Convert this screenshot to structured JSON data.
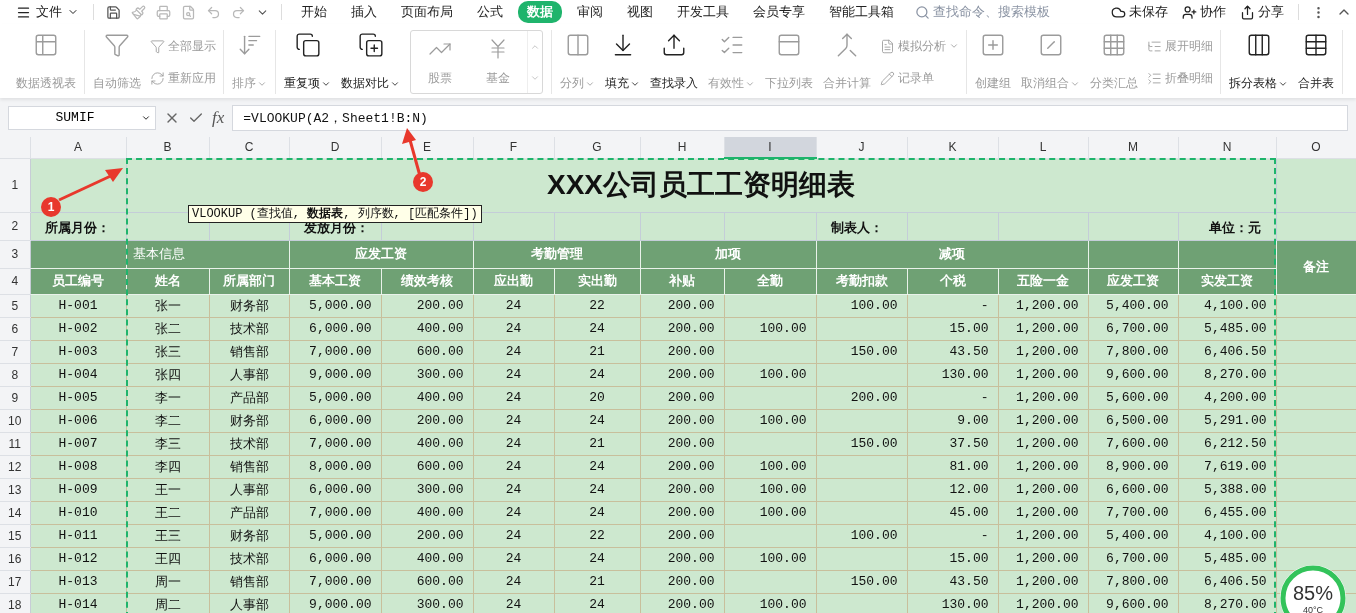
{
  "menu": {
    "file": "文件"
  },
  "tabs": [
    {
      "label": "开始",
      "selected": false
    },
    {
      "label": "插入",
      "selected": false
    },
    {
      "label": "页面布局",
      "selected": false
    },
    {
      "label": "公式",
      "selected": false
    },
    {
      "label": "数据",
      "selected": true
    },
    {
      "label": "审阅",
      "selected": false
    },
    {
      "label": "视图",
      "selected": false
    },
    {
      "label": "开发工具",
      "selected": false
    },
    {
      "label": "会员专享",
      "selected": false
    },
    {
      "label": "智能工具箱",
      "selected": false
    }
  ],
  "search": {
    "placeholder": "查找命令、搜索模板"
  },
  "top_actions": [
    "未保存",
    "协作",
    "分享"
  ],
  "ribbon": [
    {
      "items": [
        {
          "kind": "large",
          "label": "数据透视表",
          "disabled": true,
          "dropdown": false
        }
      ]
    },
    {
      "items": [
        {
          "kind": "large",
          "label": "自动筛选",
          "disabled": true,
          "dropdown": false
        },
        {
          "kind": "stack",
          "items": [
            {
              "label": "全部显示",
              "disabled": true,
              "dropdown": false
            },
            {
              "label": "重新应用",
              "disabled": true,
              "dropdown": false
            }
          ]
        }
      ]
    },
    {
      "items": [
        {
          "kind": "large",
          "label": "排序",
          "disabled": true,
          "dropdown": true
        }
      ]
    },
    {
      "items": [
        {
          "kind": "large",
          "label": "重复项",
          "disabled": false,
          "dropdown": true
        },
        {
          "kind": "large",
          "label": "数据对比",
          "disabled": false,
          "dropdown": true
        },
        {
          "kind": "gallery",
          "items": [
            {
              "label": "股票",
              "disabled": true
            },
            {
              "label": "基金",
              "disabled": true
            }
          ]
        }
      ]
    },
    {
      "items": [
        {
          "kind": "large",
          "label": "分列",
          "disabled": true,
          "dropdown": true
        },
        {
          "kind": "large",
          "label": "填充",
          "disabled": false,
          "dropdown": true
        },
        {
          "kind": "large",
          "label": "查找录入",
          "disabled": false,
          "dropdown": false
        },
        {
          "kind": "large",
          "label": "有效性",
          "disabled": true,
          "dropdown": true
        },
        {
          "kind": "large",
          "label": "下拉列表",
          "disabled": true,
          "dropdown": false
        },
        {
          "kind": "large",
          "label": "合并计算",
          "disabled": true,
          "dropdown": false
        },
        {
          "kind": "stack",
          "items": [
            {
              "label": "模拟分析",
              "disabled": true,
              "dropdown": true
            },
            {
              "label": "记录单",
              "disabled": true,
              "dropdown": false
            }
          ]
        }
      ]
    },
    {
      "items": [
        {
          "kind": "large",
          "label": "创建组",
          "disabled": true,
          "dropdown": false
        },
        {
          "kind": "large",
          "label": "取消组合",
          "disabled": true,
          "dropdown": true
        },
        {
          "kind": "large",
          "label": "分类汇总",
          "disabled": true,
          "dropdown": false
        },
        {
          "kind": "stack",
          "items": [
            {
              "label": "展开明细",
              "disabled": true,
              "dropdown": false
            },
            {
              "label": "折叠明细",
              "disabled": true,
              "dropdown": false
            }
          ]
        }
      ]
    },
    {
      "items": [
        {
          "kind": "large",
          "label": "拆分表格",
          "disabled": false,
          "dropdown": true
        },
        {
          "kind": "large",
          "label": "合并表",
          "disabled": false,
          "dropdown": false
        }
      ]
    }
  ],
  "formula_bar": {
    "name_box": "SUMIF",
    "fx_label": "fx",
    "formula": "=VLOOKUP(A2，Sheet1!B:N)"
  },
  "column_letters": [
    {
      "letter": "A",
      "selected": false
    },
    {
      "letter": "B",
      "selected": false
    },
    {
      "letter": "C",
      "selected": false
    },
    {
      "letter": "D",
      "selected": false
    },
    {
      "letter": "E",
      "selected": false
    },
    {
      "letter": "F",
      "selected": false
    },
    {
      "letter": "G",
      "selected": false
    },
    {
      "letter": "H",
      "selected": false
    },
    {
      "letter": "I",
      "selected": true
    },
    {
      "letter": "J",
      "selected": false
    },
    {
      "letter": "K",
      "selected": false
    },
    {
      "letter": "L",
      "selected": false
    },
    {
      "letter": "M",
      "selected": false
    },
    {
      "letter": "N",
      "selected": false
    },
    {
      "letter": "O",
      "selected": false
    }
  ],
  "row_numbers": [
    "1",
    "2",
    "3",
    "4",
    "5",
    "6",
    "7",
    "8",
    "9",
    "10",
    "11",
    "12",
    "13",
    "14",
    "15",
    "16",
    "17",
    "18"
  ],
  "sheet": {
    "title": "XXX公司员工工资明细表",
    "info_row": [
      "所属月份：",
      "发放月份：",
      "制表人：",
      "单位：元"
    ],
    "groups": [
      "基本信息",
      "应发工资",
      "考勤管理",
      "加项",
      "减项"
    ],
    "remarks_header": "备注",
    "headers": [
      "员工编号",
      "姓名",
      "所属部门",
      "基本工资",
      "绩效考核",
      "应出勤",
      "实出勤",
      "补贴",
      "全勤",
      "考勤扣款",
      "个税",
      "五险一金",
      "应发工资",
      "实发工资"
    ],
    "rows": [
      [
        "H-001",
        "张一",
        "财务部",
        "5,000.00",
        "200.00",
        "24",
        "22",
        "200.00",
        null,
        "100.00",
        "-",
        "1,200.00",
        "5,400.00",
        "4,100.00"
      ],
      [
        "H-002",
        "张二",
        "技术部",
        "6,000.00",
        "400.00",
        "24",
        "24",
        "200.00",
        "100.00",
        null,
        "15.00",
        "1,200.00",
        "6,700.00",
        "5,485.00"
      ],
      [
        "H-003",
        "张三",
        "销售部",
        "7,000.00",
        "600.00",
        "24",
        "21",
        "200.00",
        null,
        "150.00",
        "43.50",
        "1,200.00",
        "7,800.00",
        "6,406.50"
      ],
      [
        "H-004",
        "张四",
        "人事部",
        "9,000.00",
        "300.00",
        "24",
        "24",
        "200.00",
        "100.00",
        null,
        "130.00",
        "1,200.00",
        "9,600.00",
        "8,270.00"
      ],
      [
        "H-005",
        "李一",
        "产品部",
        "5,000.00",
        "400.00",
        "24",
        "20",
        "200.00",
        null,
        "200.00",
        "-",
        "1,200.00",
        "5,600.00",
        "4,200.00"
      ],
      [
        "H-006",
        "李二",
        "财务部",
        "6,000.00",
        "200.00",
        "24",
        "24",
        "200.00",
        "100.00",
        null,
        "9.00",
        "1,200.00",
        "6,500.00",
        "5,291.00"
      ],
      [
        "H-007",
        "李三",
        "技术部",
        "7,000.00",
        "400.00",
        "24",
        "21",
        "200.00",
        null,
        "150.00",
        "37.50",
        "1,200.00",
        "7,600.00",
        "6,212.50"
      ],
      [
        "H-008",
        "李四",
        "销售部",
        "8,000.00",
        "600.00",
        "24",
        "24",
        "200.00",
        "100.00",
        null,
        "81.00",
        "1,200.00",
        "8,900.00",
        "7,619.00"
      ],
      [
        "H-009",
        "王一",
        "人事部",
        "6,000.00",
        "300.00",
        "24",
        "24",
        "200.00",
        "100.00",
        null,
        "12.00",
        "1,200.00",
        "6,600.00",
        "5,388.00"
      ],
      [
        "H-010",
        "王二",
        "产品部",
        "7,000.00",
        "400.00",
        "24",
        "24",
        "200.00",
        "100.00",
        null,
        "45.00",
        "1,200.00",
        "7,700.00",
        "6,455.00"
      ],
      [
        "H-011",
        "王三",
        "财务部",
        "5,000.00",
        "200.00",
        "24",
        "22",
        "200.00",
        null,
        "100.00",
        "-",
        "1,200.00",
        "5,400.00",
        "4,100.00"
      ],
      [
        "H-012",
        "王四",
        "技术部",
        "6,000.00",
        "400.00",
        "24",
        "24",
        "200.00",
        "100.00",
        null,
        "15.00",
        "1,200.00",
        "6,700.00",
        "5,485.00"
      ],
      [
        "H-013",
        "周一",
        "销售部",
        "7,000.00",
        "600.00",
        "24",
        "21",
        "200.00",
        null,
        "150.00",
        "43.50",
        "1,200.00",
        "7,800.00",
        "6,406.50"
      ],
      [
        "H-014",
        "周二",
        "人事部",
        "9,000.00",
        "300.00",
        "24",
        "24",
        "200.00",
        "100.00",
        null,
        "130.00",
        "1,200.00",
        "9,600.00",
        "8,270.00"
      ]
    ]
  },
  "tooltip": "VLOOKUP (查找值, **数据表**, 列序数, [匹配条件])",
  "annotations": [
    "1",
    "2"
  ],
  "monitor": {
    "reading": "85%",
    "temperature": "40°C"
  }
}
